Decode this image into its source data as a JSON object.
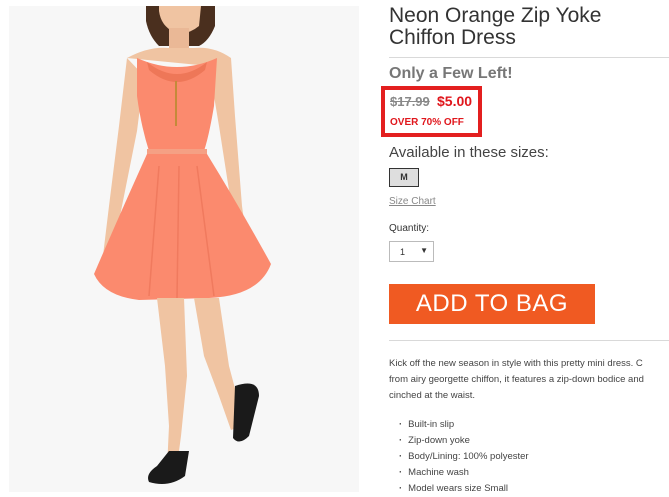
{
  "product": {
    "title": "Neon Orange Zip Yoke Chiffon Dress",
    "stock_status": "Only a Few Left!",
    "old_price": "$17.99",
    "new_price": "$5.00",
    "savings": "OVER 70% OFF",
    "sizes_label": "Available in these sizes:",
    "sizes": [
      "M"
    ],
    "size_chart_label": "Size Chart",
    "quantity_label": "Quantity:",
    "quantity_value": "1",
    "add_to_bag_label": "ADD TO BAG",
    "description_lines": [
      "Kick off the new season in style with this pretty mini dress. C",
      "from airy georgette chiffon, it features a zip-down bodice and",
      "cinched at the waist."
    ],
    "features": [
      "Built-in slip",
      "Zip-down yoke",
      "Body/Lining: 100% polyester",
      "Machine wash",
      "Model wears size Small"
    ]
  },
  "colors": {
    "price_red": "#e0161c",
    "highlight_box": "#e31f1f",
    "add_to_bag": "#f05a22",
    "dress": "#fb8a6e"
  },
  "icons": {
    "dropdown": "chevron-down-icon"
  }
}
